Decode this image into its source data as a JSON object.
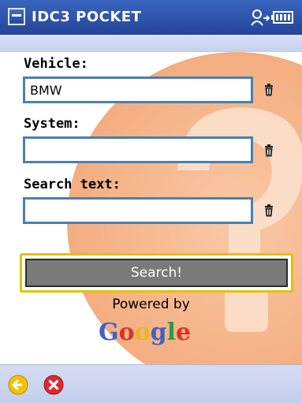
{
  "titlebar": {
    "title": "IDC3 POCKET",
    "icons": [
      "windows-start-icon",
      "connectivity-icon",
      "battery-icon"
    ]
  },
  "form": {
    "vehicle_label": "Vehicle:",
    "vehicle_value": "BMW",
    "system_label": "System:",
    "system_value": "",
    "search_text_label": "Search text:",
    "search_text_value": "",
    "clear_icon": "trash-can-icon"
  },
  "search": {
    "button_label": "Search!"
  },
  "footer": {
    "powered_by": "Powered by",
    "brand": "Google"
  },
  "bottombar": {
    "icons": [
      "back-arrow-icon",
      "close-icon"
    ]
  },
  "colors": {
    "titlebar": "#24459a",
    "input_border": "#4a7fb2",
    "button_highlight": "#e2c200",
    "button_fill": "#7a7a7a",
    "watermark": "#f4b48a",
    "back_icon": "#f2c200",
    "close_icon": "#e0282f"
  }
}
